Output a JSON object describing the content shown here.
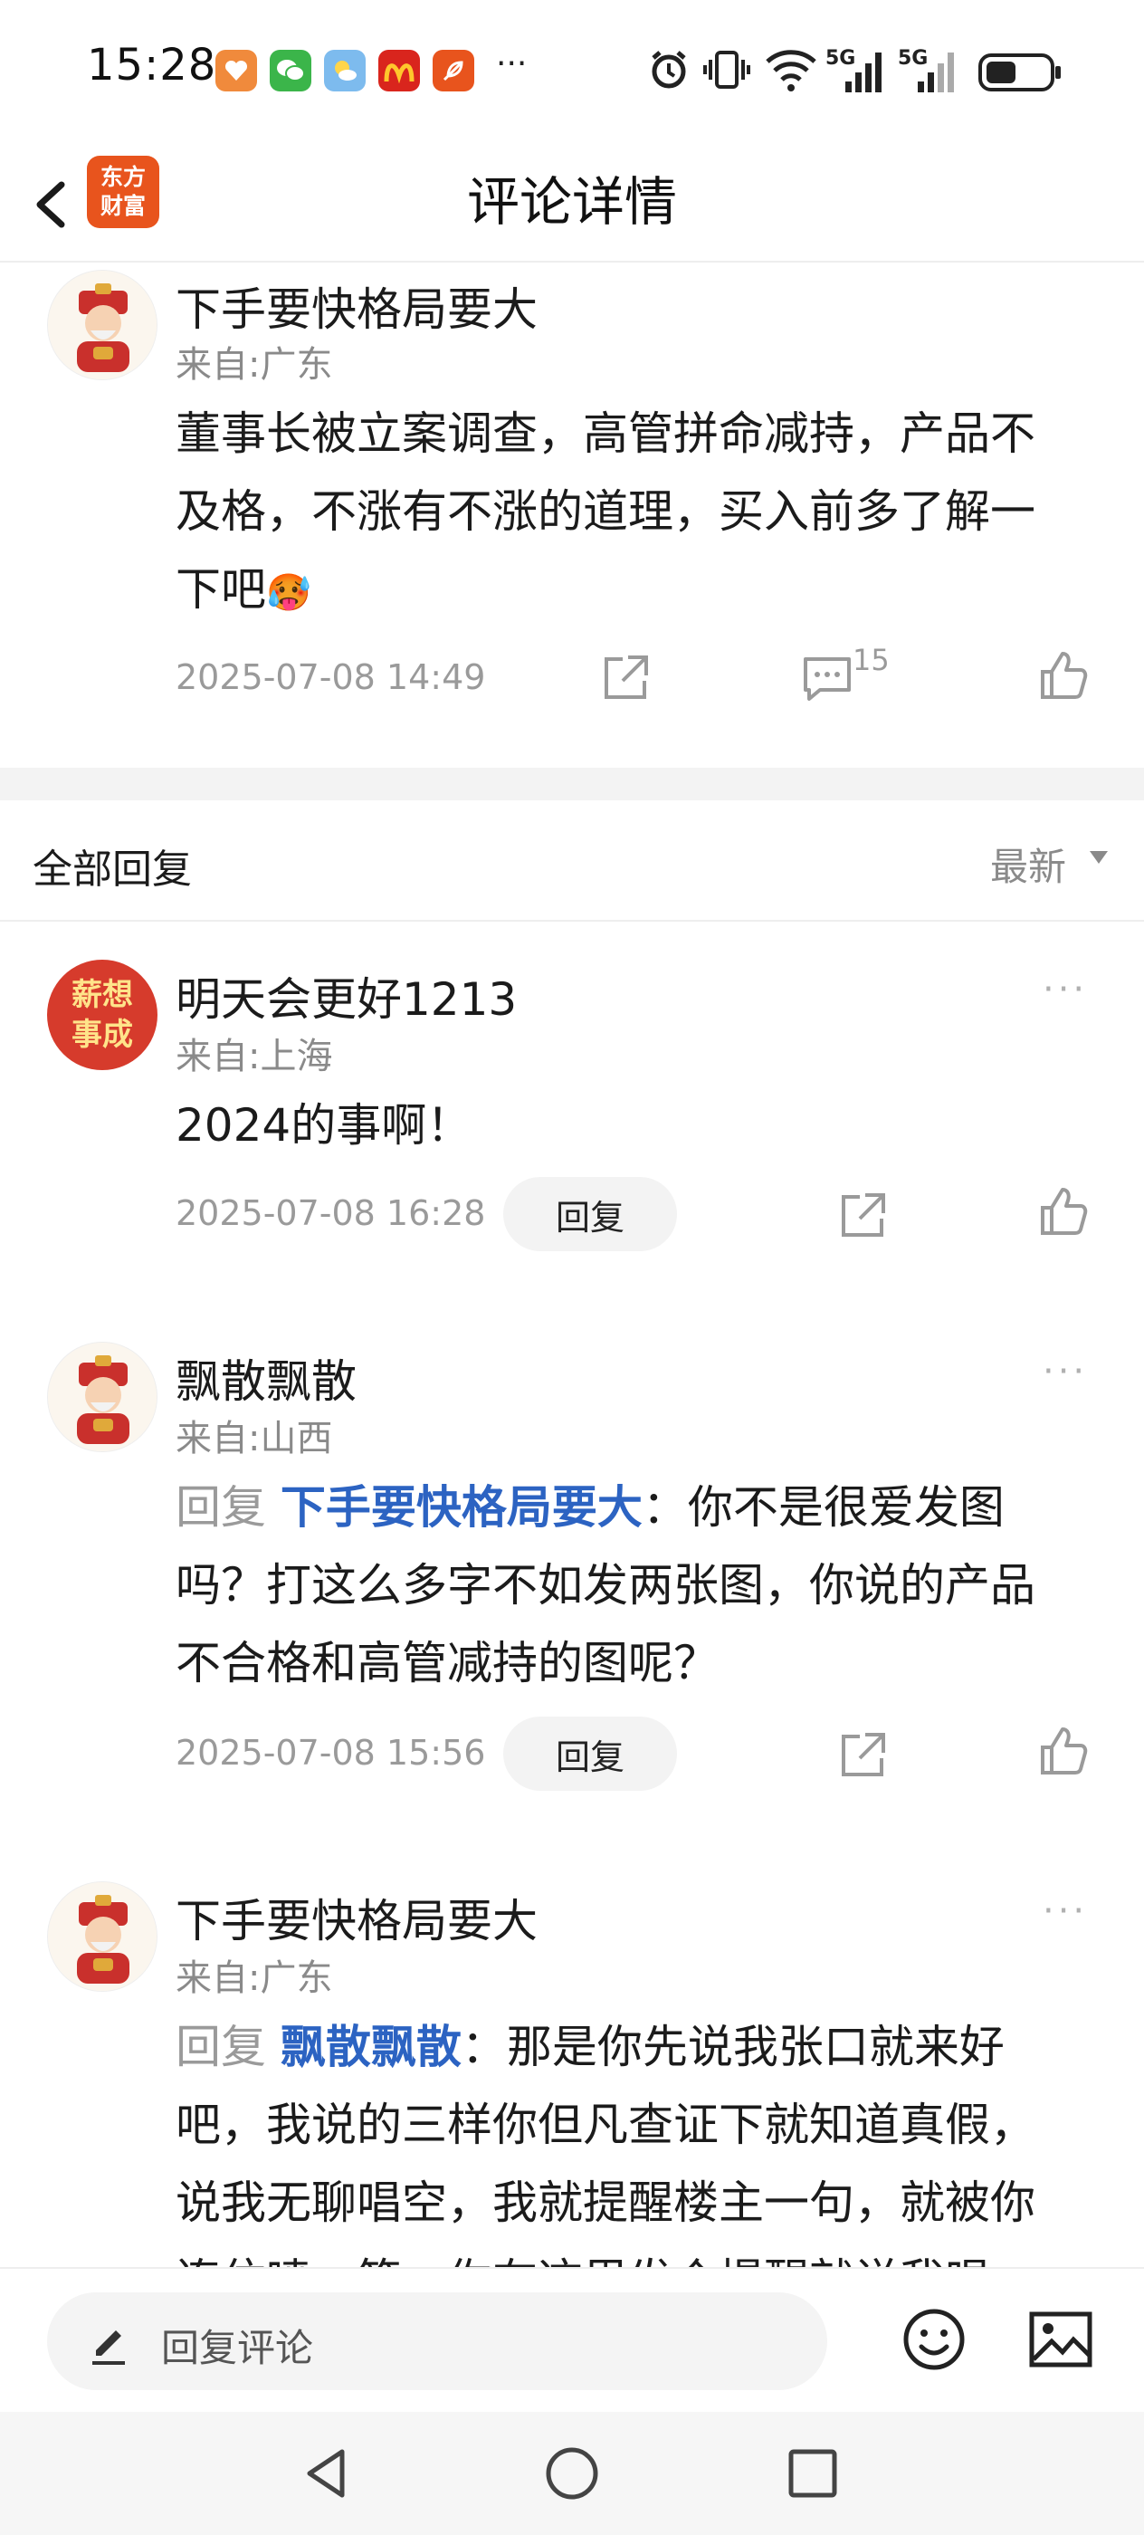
{
  "status_bar": {
    "time": "15:28",
    "more": "···",
    "network_1": "5G",
    "network_2": "5G",
    "battery_icon": "battery-icon"
  },
  "header": {
    "logo_line1": "东方",
    "logo_line2": "财富",
    "title": "评论详情"
  },
  "main_post": {
    "username": "下手要快格局要大",
    "location": "来自:广东",
    "lines": [
      "董事长被立案调查，高管拼命减持，产品不",
      "及格，不涨有不涨的道理，买入前多了解一",
      "下吧"
    ],
    "emoji": "🥵",
    "timestamp": "2025-07-08 14:49",
    "comment_count": "15"
  },
  "replies_section": {
    "title": "全部回复",
    "sort_label": "最新"
  },
  "replies": [
    {
      "username": "明天会更好1213",
      "location": "来自:上海",
      "avatar_text_1": "薪想",
      "avatar_text_2": "事成",
      "lines": [
        "2024的事啊！"
      ],
      "timestamp": "2025-07-08 16:28",
      "reply_label": "回复",
      "more": "···"
    },
    {
      "username": "飘散飘散",
      "location": "来自:山西",
      "reply_prefix": "回复 ",
      "reply_target": "下手要快格局要大",
      "line1_rest": "：你不是很爱发图",
      "lines": [
        "吗？打这么多字不如发两张图，你说的产品",
        "不合格和高管减持的图呢？"
      ],
      "timestamp": "2025-07-08 15:56",
      "reply_label": "回复",
      "more": "···"
    },
    {
      "username": "下手要快格局要大",
      "location": "来自:广东",
      "reply_prefix": "回复 ",
      "reply_target": "飘散飘散",
      "line1_rest": "：那是你先说我张口就来好",
      "lines": [
        "吧，我说的三样你但凡查证下就知道真假，",
        "说我无聊唱空，我就提醒楼主一句，就被你",
        "连住喷一笔，你在这里发个提醒就说我唱"
      ],
      "more": "···"
    }
  ],
  "input_bar": {
    "placeholder": "回复评论"
  },
  "colors": {
    "brand": "#e8541d",
    "link_blue": "#2c63c2",
    "muted": "#9a9a9a"
  }
}
